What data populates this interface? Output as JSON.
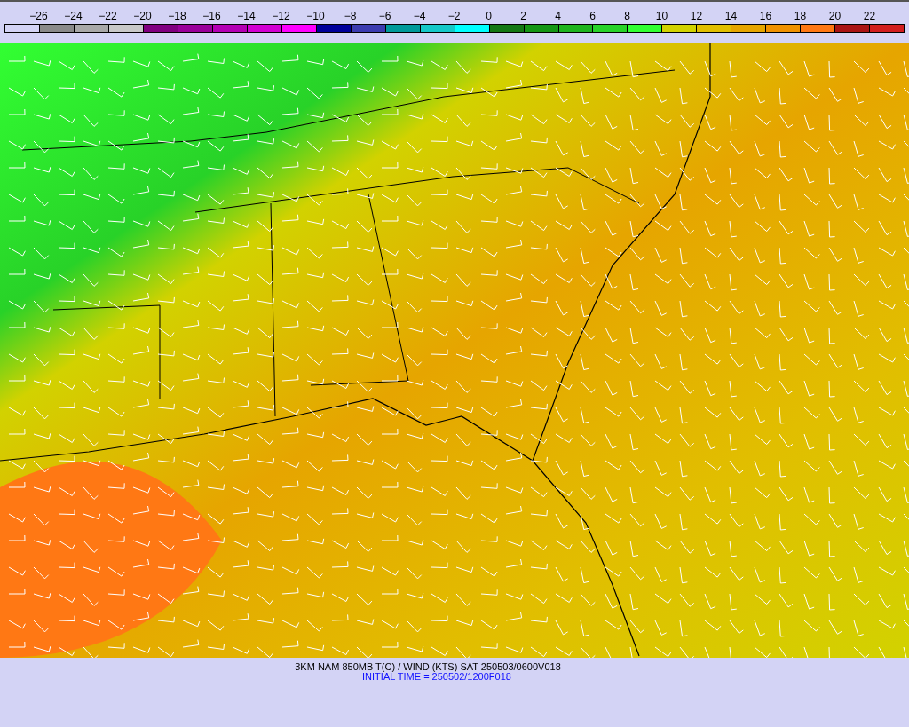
{
  "legend": {
    "labels": [
      "−26",
      "−24",
      "−22",
      "−20",
      "−18",
      "−16",
      "−14",
      "−12",
      "−10",
      "−8",
      "−6",
      "−4",
      "−2",
      "0",
      "2",
      "4",
      "6",
      "8",
      "10",
      "12",
      "14",
      "16",
      "18",
      "20",
      "22"
    ],
    "swatches": [
      {
        "color": "#d3d3f5"
      },
      {
        "color": "#8a8a8a"
      },
      {
        "color": "#a8a8a8"
      },
      {
        "color": "#c8c8c8"
      },
      {
        "color": "#800080"
      },
      {
        "color": "#9a009a"
      },
      {
        "color": "#b400b4"
      },
      {
        "color": "#d200d2"
      },
      {
        "color": "#ff00ff"
      },
      {
        "color": "#00009a"
      },
      {
        "color": "#3c3cb0"
      },
      {
        "color": "#009a9a"
      },
      {
        "color": "#14c8c8"
      },
      {
        "color": "#00ffff"
      },
      {
        "color": "#147814"
      },
      {
        "color": "#149614"
      },
      {
        "color": "#1eb41e"
      },
      {
        "color": "#28d228"
      },
      {
        "color": "#32ff32"
      },
      {
        "color": "#d2d200"
      },
      {
        "color": "#e1be00"
      },
      {
        "color": "#e6a500"
      },
      {
        "color": "#f09100"
      },
      {
        "color": "#ff7814"
      },
      {
        "color": "#aa1414"
      },
      {
        "color": "#d21e1e"
      }
    ]
  },
  "caption": {
    "title": "3KM NAM 850MB T(C) / WIND (KTS) SAT 250503/0600V018",
    "initial_time": "INITIAL TIME = 250502/1200F018"
  }
}
